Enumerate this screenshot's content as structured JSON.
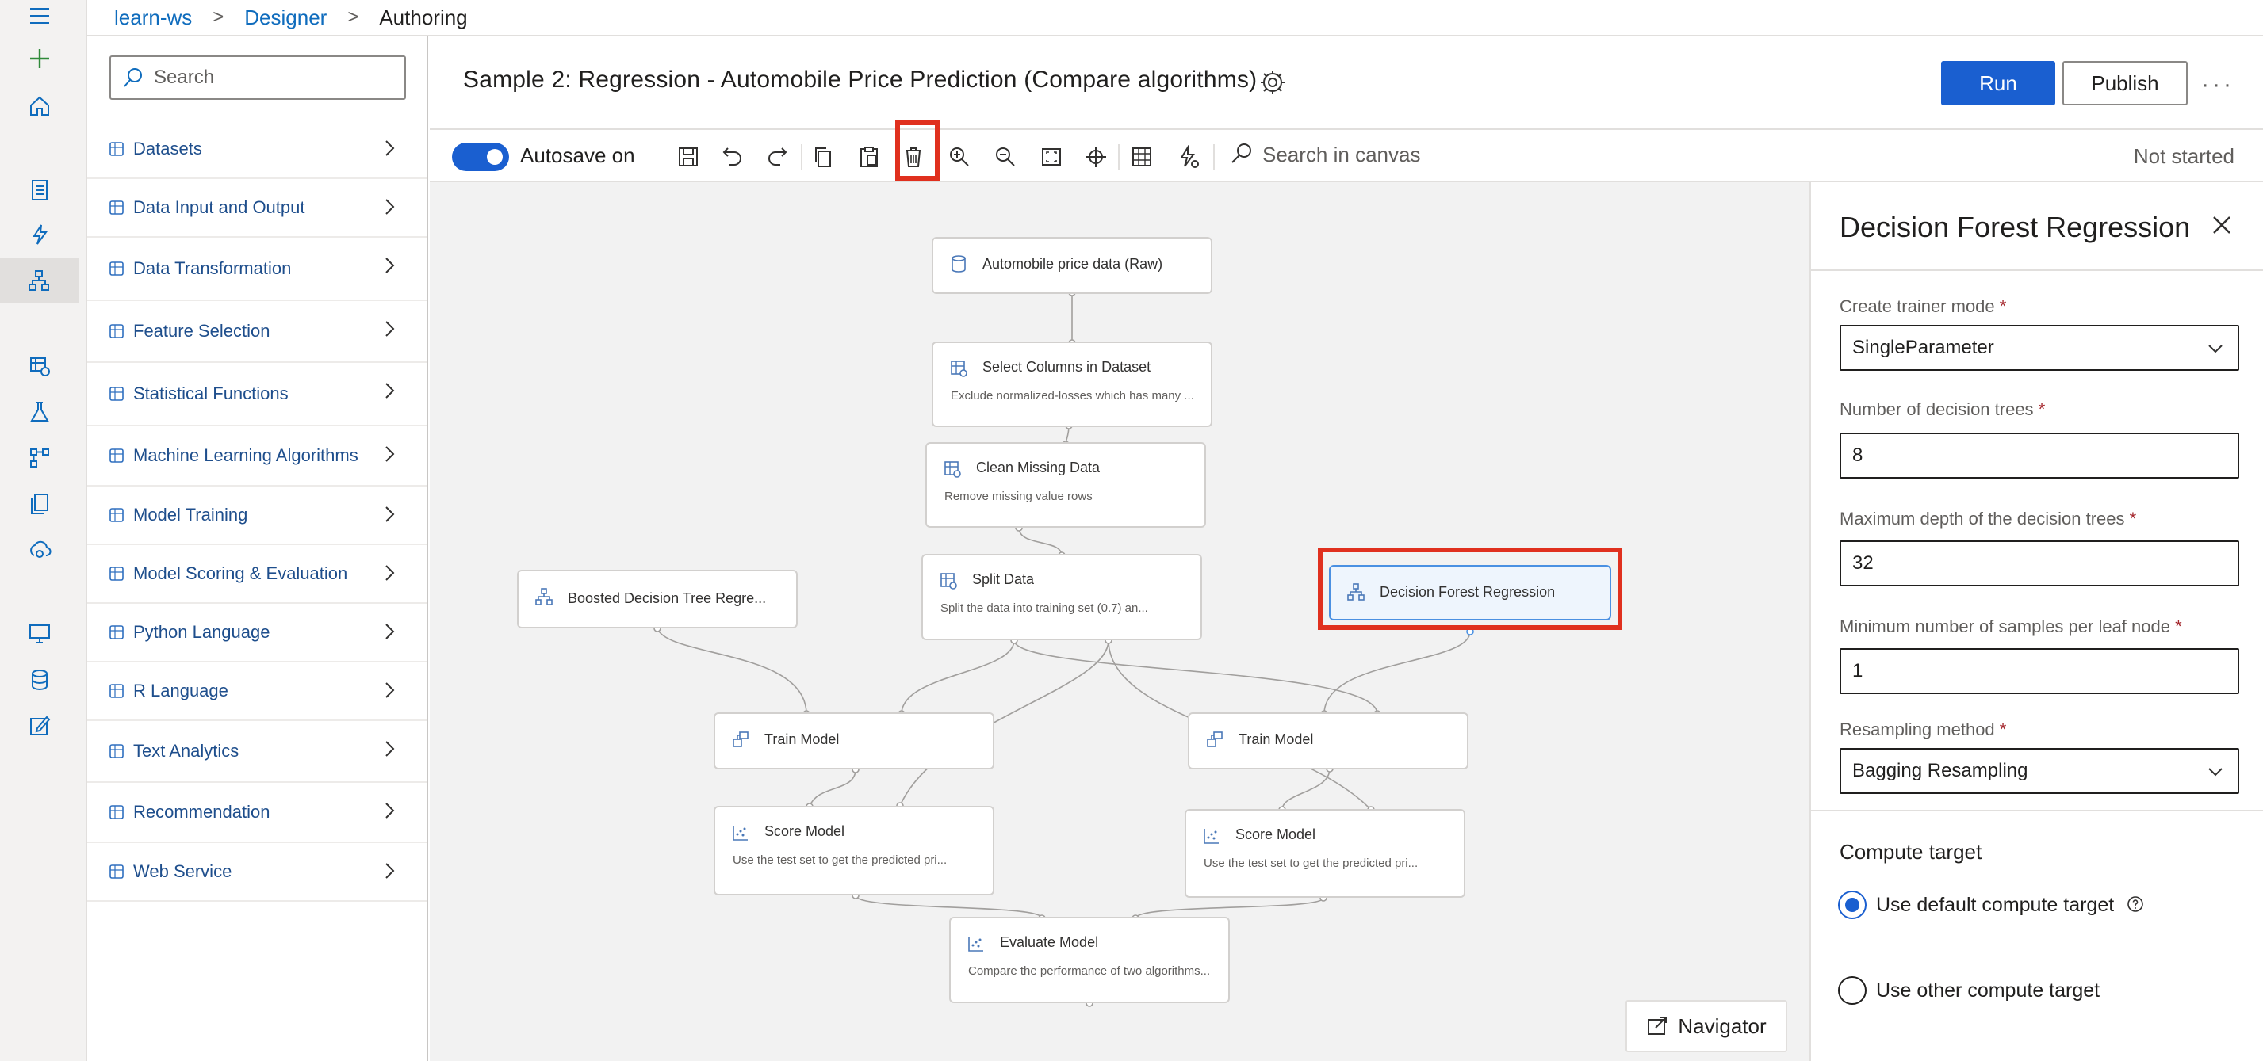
{
  "breadcrumb": {
    "workspace": "learn-ws",
    "section": "Designer",
    "current": "Authoring"
  },
  "palette": {
    "search_placeholder": "Search",
    "categories": [
      {
        "label": "Datasets",
        "icon": "database-icon"
      },
      {
        "label": "Data Input and Output",
        "icon": "data-io-icon"
      },
      {
        "label": "Data Transformation",
        "icon": "data-transform-icon"
      },
      {
        "label": "Feature Selection",
        "icon": "feature-selection-icon"
      },
      {
        "label": "Statistical Functions",
        "icon": "statistics-icon"
      },
      {
        "label": "Machine Learning Algorithms",
        "icon": "algorithm-icon"
      },
      {
        "label": "Model Training",
        "icon": "training-icon"
      },
      {
        "label": "Model Scoring & Evaluation",
        "icon": "scoring-icon"
      },
      {
        "label": "Python Language",
        "icon": "python-icon"
      },
      {
        "label": "R Language",
        "icon": "r-language-icon"
      },
      {
        "label": "Text Analytics",
        "icon": "text-analytics-icon"
      },
      {
        "label": "Recommendation",
        "icon": "lightbulb-icon"
      },
      {
        "label": "Web Service",
        "icon": "globe-icon"
      }
    ]
  },
  "header": {
    "title": "Sample 2: Regression - Automobile Price Prediction (Compare algorithms)",
    "run_label": "Run",
    "publish_label": "Publish",
    "more_label": "···"
  },
  "toolbar": {
    "autosave_label": "Autosave on",
    "autosave_on": true,
    "canvas_search_placeholder": "Search in canvas",
    "status": "Not started"
  },
  "canvas": {
    "nodes": [
      {
        "id": "n1",
        "title": "Automobile price data (Raw)",
        "desc": ""
      },
      {
        "id": "n2",
        "title": "Select Columns in Dataset",
        "desc": "Exclude normalized-losses which has many ..."
      },
      {
        "id": "n3",
        "title": "Clean Missing Data",
        "desc": "Remove missing value rows"
      },
      {
        "id": "n4",
        "title": "Split Data",
        "desc": "Split the data into training set (0.7) an..."
      },
      {
        "id": "n5",
        "title": "Boosted Decision Tree Regre...",
        "desc": ""
      },
      {
        "id": "n6",
        "title": "Decision Forest Regression",
        "desc": ""
      },
      {
        "id": "n7",
        "title": "Train Model",
        "desc": ""
      },
      {
        "id": "n8",
        "title": "Train Model",
        "desc": ""
      },
      {
        "id": "n9",
        "title": "Score Model",
        "desc": "Use the test set to get the predicted pri..."
      },
      {
        "id": "n10",
        "title": "Score Model",
        "desc": "Use the test set to get the predicted pri..."
      },
      {
        "id": "n11",
        "title": "Evaluate Model",
        "desc": "Compare the performance of two algorithms..."
      }
    ],
    "navigator_label": "Navigator"
  },
  "properties": {
    "title": "Decision Forest Regression",
    "trainer_mode_label": "Create trainer mode",
    "trainer_mode_value": "SingleParameter",
    "num_trees_label": "Number of decision trees",
    "num_trees_value": "8",
    "max_depth_label": "Maximum depth of the decision trees",
    "max_depth_value": "32",
    "min_samples_label": "Minimum number of samples per leaf node",
    "min_samples_value": "1",
    "resampling_label": "Resampling method",
    "resampling_value": "Bagging Resampling",
    "required_marker": "*",
    "compute_title": "Compute target",
    "compute_default_label": "Use default compute target",
    "compute_other_label": "Use other compute target",
    "compute_selected": "default"
  },
  "colors": {
    "accent": "#1a5fd0",
    "highlight": "#e0301e",
    "link": "#0f6cbd",
    "canvas_bg": "#f2f2f2"
  }
}
